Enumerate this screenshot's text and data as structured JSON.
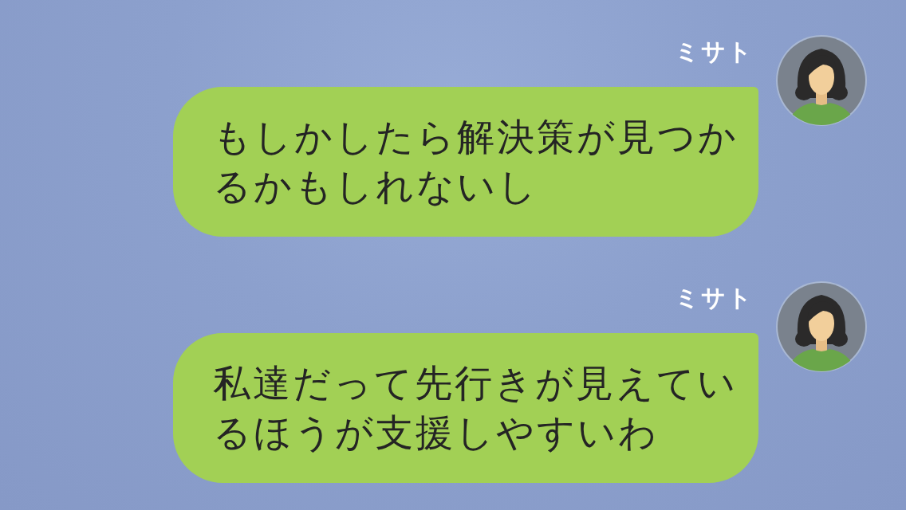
{
  "messages": [
    {
      "sender": "ミサト",
      "text": "もしかしたら解決策が見つかるかもしれないし"
    },
    {
      "sender": "ミサト",
      "text": "私達だって先行きが見えているほうが支援しやすいわ"
    }
  ]
}
